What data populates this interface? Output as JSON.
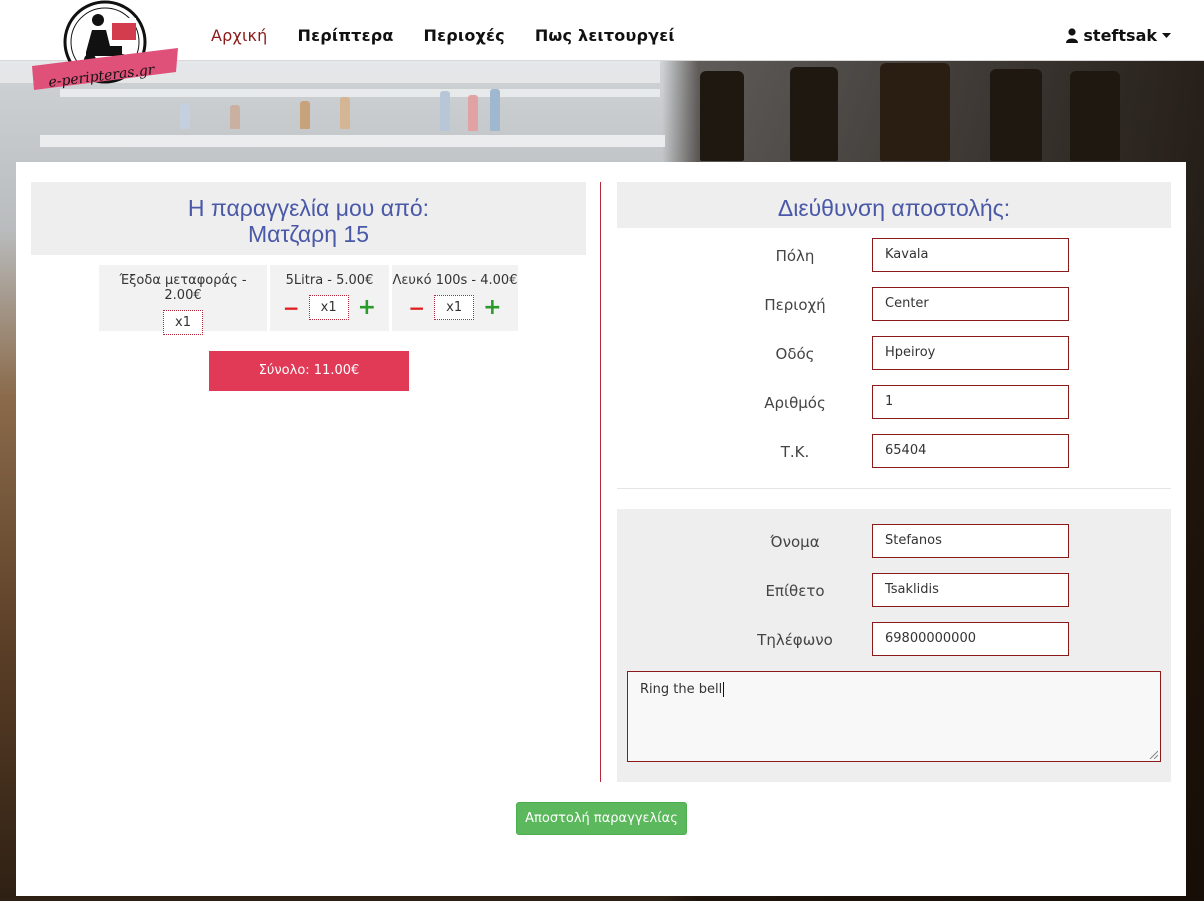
{
  "brand": {
    "logo_text": "e-peripteras.gr"
  },
  "nav": {
    "items": [
      {
        "label": "Αρχική",
        "active": true
      },
      {
        "label": "Περίπτερα",
        "active": false
      },
      {
        "label": "Περιοχές",
        "active": false
      },
      {
        "label": "Πως λειτουργεί",
        "active": false
      }
    ],
    "user": {
      "icon": "user-icon",
      "name": "steftsak",
      "caret": "caret-down-icon"
    }
  },
  "order": {
    "title_line1": "Η παραγγελία μου από:",
    "title_line2": "Ματζαρη 15",
    "items": [
      {
        "label": "Έξοδα μεταφοράς - 2.00€",
        "qty": "x1",
        "editable": false
      },
      {
        "label": "5Litra - 5.00€",
        "qty": "x1",
        "editable": true
      },
      {
        "label": "Λευκό 100s - 4.00€",
        "qty": "x1",
        "editable": true
      }
    ],
    "minus_symbol": "−",
    "plus_symbol": "+",
    "total_label": "Σύνολο: 11.00€"
  },
  "address": {
    "title": "Διεύθυνση αποστολής:",
    "fields": [
      {
        "label": "Πόλη",
        "value": "Kavala"
      },
      {
        "label": "Περιοχή",
        "value": "Center"
      },
      {
        "label": "Οδός",
        "value": "Hpeiroy"
      },
      {
        "label": "Αριθμός",
        "value": "1"
      },
      {
        "label": "Τ.Κ.",
        "value": "65404"
      }
    ]
  },
  "contact": {
    "fields": [
      {
        "label": "Όνομα",
        "value": "Stefanos"
      },
      {
        "label": "Επίθετο",
        "value": "Tsaklidis"
      },
      {
        "label": "Τηλέφωνο",
        "value": "69800000000"
      }
    ],
    "notes": "Ring the bell"
  },
  "submit_label": "Αποστολή παραγγελίας",
  "colors": {
    "accent_red": "#8b1a1a",
    "title_blue": "#4a58a8",
    "total_bg": "#e03a57",
    "submit_green": "#5cb85c"
  }
}
